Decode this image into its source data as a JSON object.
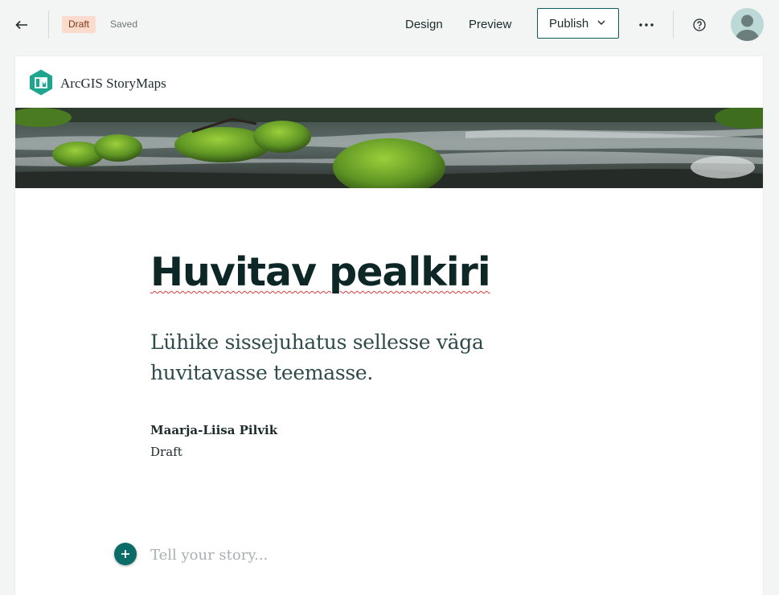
{
  "toolbar": {
    "back_icon": "arrow-left-icon",
    "status_badge": "Draft",
    "saved_label": "Saved",
    "design_label": "Design",
    "preview_label": "Preview",
    "publish_label": "Publish",
    "publish_icon": "chevron-down-icon",
    "more_icon": "more-horizontal-icon",
    "help_icon": "help-circle-icon",
    "avatar_icon": "user-avatar-icon"
  },
  "brand": {
    "logo_icon": "storymaps-logo-icon",
    "name": "ArcGIS StoryMaps"
  },
  "story": {
    "title": "Huvitav pealkiri",
    "intro": "Lühike sissejuhatus sellesse väga huvitavasse teemasse.",
    "author": "Maarja-Liisa Pilvik",
    "status": "Draft",
    "add_block_icon": "plus-icon",
    "body_placeholder": "Tell your story..."
  },
  "colors": {
    "accent": "#0b6b66",
    "draft_badge_bg": "#fbdccc",
    "page_bg": "#f3f4f4"
  }
}
